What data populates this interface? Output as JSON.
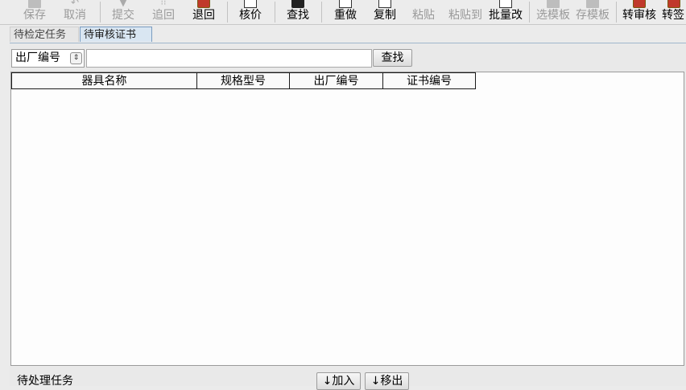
{
  "toolbar": {
    "buttons": [
      {
        "label": "保存",
        "icon": "save-icon",
        "enabled": false
      },
      {
        "label": "取消",
        "icon": "undo-icon",
        "enabled": false
      },
      {
        "label": "提交",
        "icon": "submit-icon",
        "enabled": false
      },
      {
        "label": "追回",
        "icon": "recall-icon",
        "enabled": false
      },
      {
        "label": "退回",
        "icon": "return-icon",
        "enabled": true
      },
      {
        "label": "核价",
        "icon": "price-check-icon",
        "enabled": true
      },
      {
        "label": "查找",
        "icon": "binoculars-icon",
        "enabled": true
      },
      {
        "label": "重做",
        "icon": "redo-icon",
        "enabled": true
      },
      {
        "label": "复制",
        "icon": "copy-icon",
        "enabled": true
      },
      {
        "label": "粘贴",
        "icon": "paste-icon",
        "enabled": false
      },
      {
        "label": "粘贴到",
        "icon": "paste-to-icon",
        "enabled": false
      },
      {
        "label": "批量改",
        "icon": "batch-edit-icon",
        "enabled": true
      },
      {
        "label": "选模板",
        "icon": "select-template-icon",
        "enabled": false
      },
      {
        "label": "存模板",
        "icon": "save-template-icon",
        "enabled": false
      },
      {
        "label": "转审核",
        "icon": "transfer-review-icon",
        "enabled": true
      },
      {
        "label": "转签",
        "icon": "transfer-sign-icon",
        "enabled": true
      }
    ]
  },
  "tabs": [
    {
      "label": "待检定任务",
      "active": false
    },
    {
      "label": "待审核证书",
      "active": true
    }
  ],
  "search": {
    "field_select": "出厂编号",
    "input_value": "",
    "button_label": "查找"
  },
  "table": {
    "columns": [
      "器具名称",
      "规格型号",
      "出厂编号",
      "证书编号"
    ],
    "rows": []
  },
  "footer": {
    "label": "待处理任务",
    "add_label": "↓加入",
    "remove_label": "↓移出"
  },
  "colors": {
    "active_tab_bg": "#d9e6f2",
    "disabled_text": "#9a9a9a"
  }
}
